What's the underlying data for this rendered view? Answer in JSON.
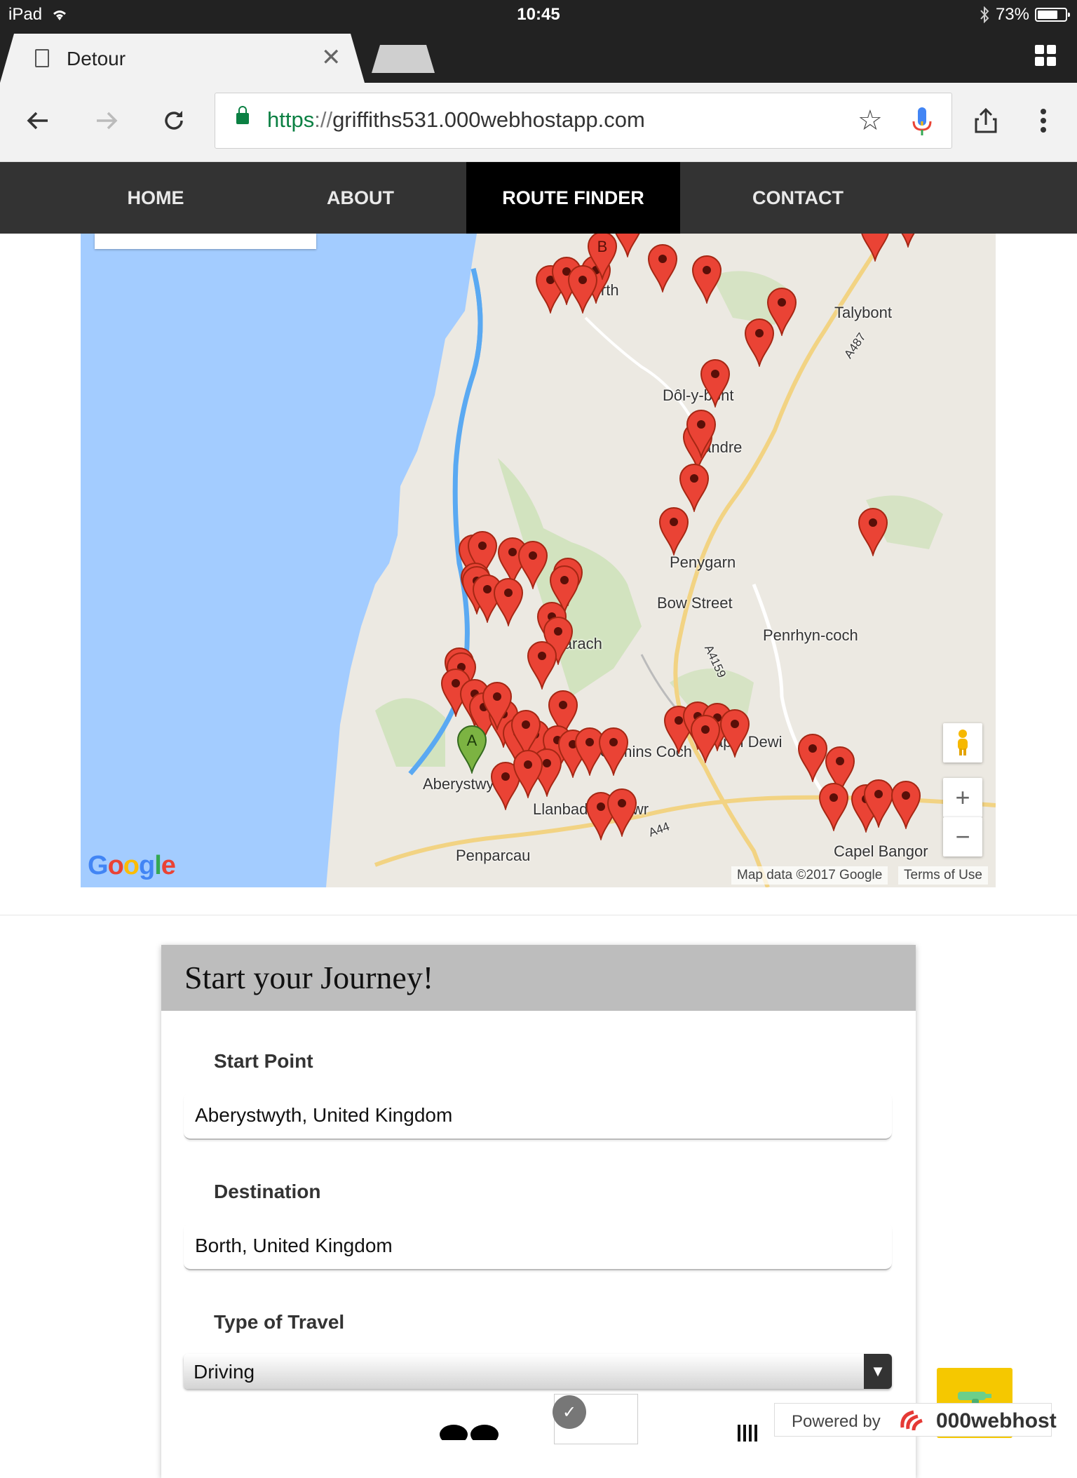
{
  "status_bar": {
    "device": "iPad",
    "time": "10:45",
    "battery": "73%",
    "battery_level": 0.73
  },
  "browser": {
    "tab_title": "Detour",
    "url_scheme": "https",
    "url_separator": "://",
    "url_host": "griffiths531.000webhostapp.com"
  },
  "nav": {
    "items": [
      {
        "label": "HOME"
      },
      {
        "label": "ABOUT"
      },
      {
        "label": "ROUTE FINDER"
      },
      {
        "label": "CONTACT"
      }
    ],
    "active": "ROUTE FINDER"
  },
  "map": {
    "places": [
      "Borth",
      "Talybont",
      "Dôl-y-bont",
      "Llandre",
      "Penygarn",
      "Bow Street",
      "Penrhyn-coch",
      "Clarach",
      "Comins Coch",
      "Capel Dewi",
      "Capel Bangor",
      "Aberystwyth",
      "Llanbadarn Fawr",
      "Penparcau"
    ],
    "road_labels": [
      "A487",
      "A4159",
      "A44"
    ],
    "marker_a": "A",
    "marker_b": "B",
    "logo": "Google",
    "attribution": "Map data ©2017 Google",
    "terms": "Terms of Use",
    "zoom_in": "+",
    "zoom_out": "−",
    "colors": {
      "water": "#a3ccff",
      "land": "#ece9e2",
      "route": "#5aa9f2",
      "pin": "#ea4335",
      "pin_a": "#7cb342"
    }
  },
  "form": {
    "title": "Start your Journey!",
    "start_label": "Start Point",
    "start_value": "Aberystwyth, United Kingdom",
    "destination_label": "Destination",
    "destination_value": "Borth, United Kingdom",
    "travel_label": "Type of Travel",
    "travel_value": "Driving"
  },
  "footer": {
    "powered_text": "Powered by",
    "powered_brand": "000webhost"
  }
}
